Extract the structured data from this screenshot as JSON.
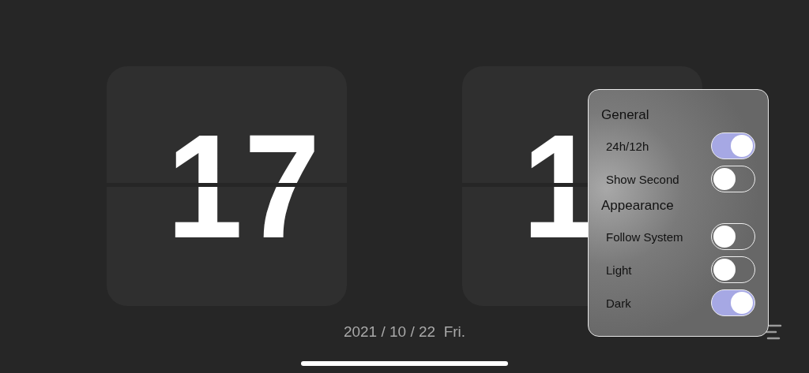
{
  "clock": {
    "cards": [
      {
        "digits": "17"
      },
      {
        "digits": "1"
      }
    ],
    "date": "2021 / 10 / 22  Fri."
  },
  "settings_popover": {
    "sections": [
      {
        "title": "General",
        "items": [
          {
            "label": "24h/12h",
            "on": true
          },
          {
            "label": "Show Second",
            "on": false
          }
        ]
      },
      {
        "title": "Appearance",
        "items": [
          {
            "label": "Follow System",
            "on": false
          },
          {
            "label": "Light",
            "on": false
          },
          {
            "label": "Dark",
            "on": true
          }
        ]
      }
    ]
  }
}
